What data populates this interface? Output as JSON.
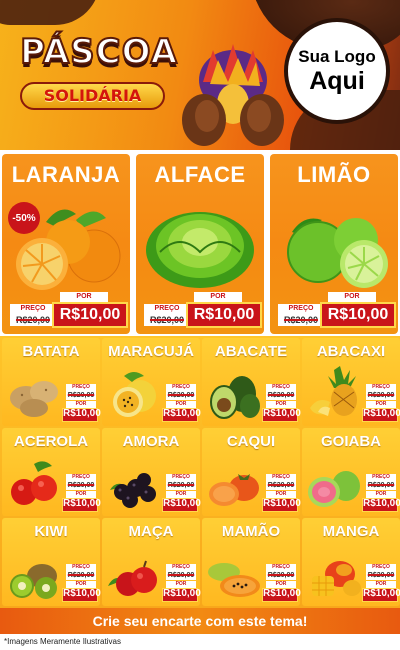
{
  "header": {
    "title": "PÁSCOA",
    "subtitle": "SOLIDÁRIA",
    "logo_line1": "Sua Logo",
    "logo_line2": "Aqui"
  },
  "featured": [
    {
      "name": "LARANJA",
      "badge": "-50%",
      "preco_label": "PREÇO",
      "old_price": "R$20,00",
      "por_label": "POR",
      "new_price": "R$10,00",
      "icon": "orange-icon"
    },
    {
      "name": "ALFACE",
      "preco_label": "PREÇO",
      "old_price": "R$20,00",
      "por_label": "POR",
      "new_price": "R$10,00",
      "icon": "lettuce-icon"
    },
    {
      "name": "LIMÃO",
      "preco_label": "PREÇO",
      "old_price": "R$20,00",
      "por_label": "POR",
      "new_price": "R$10,00",
      "icon": "lime-icon"
    }
  ],
  "products": [
    {
      "name": "BATATA",
      "preco_label": "PREÇO",
      "old_price": "R$20,00",
      "por_label": "POR",
      "new_price": "R$10,00",
      "icon": "potato-icon"
    },
    {
      "name": "MARACUJÁ",
      "preco_label": "PREÇO",
      "old_price": "R$20,00",
      "por_label": "POR",
      "new_price": "R$10,00",
      "icon": "passionfruit-icon"
    },
    {
      "name": "ABACATE",
      "preco_label": "PREÇO",
      "old_price": "R$20,00",
      "por_label": "POR",
      "new_price": "R$10,00",
      "icon": "avocado-icon"
    },
    {
      "name": "ABACAXI",
      "preco_label": "PREÇO",
      "old_price": "R$20,00",
      "por_label": "POR",
      "new_price": "R$10,00",
      "icon": "pineapple-icon"
    },
    {
      "name": "ACEROLA",
      "preco_label": "PREÇO",
      "old_price": "R$20,00",
      "por_label": "POR",
      "new_price": "R$10,00",
      "icon": "acerola-icon"
    },
    {
      "name": "AMORA",
      "preco_label": "PREÇO",
      "old_price": "R$20,00",
      "por_label": "POR",
      "new_price": "R$10,00",
      "icon": "blackberry-icon"
    },
    {
      "name": "CAQUI",
      "preco_label": "PREÇO",
      "old_price": "R$20,00",
      "por_label": "POR",
      "new_price": "R$10,00",
      "icon": "persimmon-icon"
    },
    {
      "name": "GOIABA",
      "preco_label": "PREÇO",
      "old_price": "R$20,00",
      "por_label": "POR",
      "new_price": "R$10,00",
      "icon": "guava-icon"
    },
    {
      "name": "KIWI",
      "preco_label": "PREÇO",
      "old_price": "R$20,00",
      "por_label": "POR",
      "new_price": "R$10,00",
      "icon": "kiwi-icon"
    },
    {
      "name": "MAÇA",
      "preco_label": "PREÇO",
      "old_price": "R$20,00",
      "por_label": "POR",
      "new_price": "R$10,00",
      "icon": "apple-icon"
    },
    {
      "name": "MAMÃO",
      "preco_label": "PREÇO",
      "old_price": "R$20,00",
      "por_label": "POR",
      "new_price": "R$10,00",
      "icon": "papaya-icon"
    },
    {
      "name": "MANGA",
      "preco_label": "PREÇO",
      "old_price": "R$20,00",
      "por_label": "POR",
      "new_price": "R$10,00",
      "icon": "mango-icon"
    }
  ],
  "footer": {
    "cta": "Crie seu encarte com este tema!",
    "disclaimer": "*Imagens Meramente Ilustrativas"
  },
  "colors": {
    "orange": "#f7941d",
    "yellow": "#ffc52a",
    "red": "#c9141a",
    "chocolate": "#4a200e"
  }
}
